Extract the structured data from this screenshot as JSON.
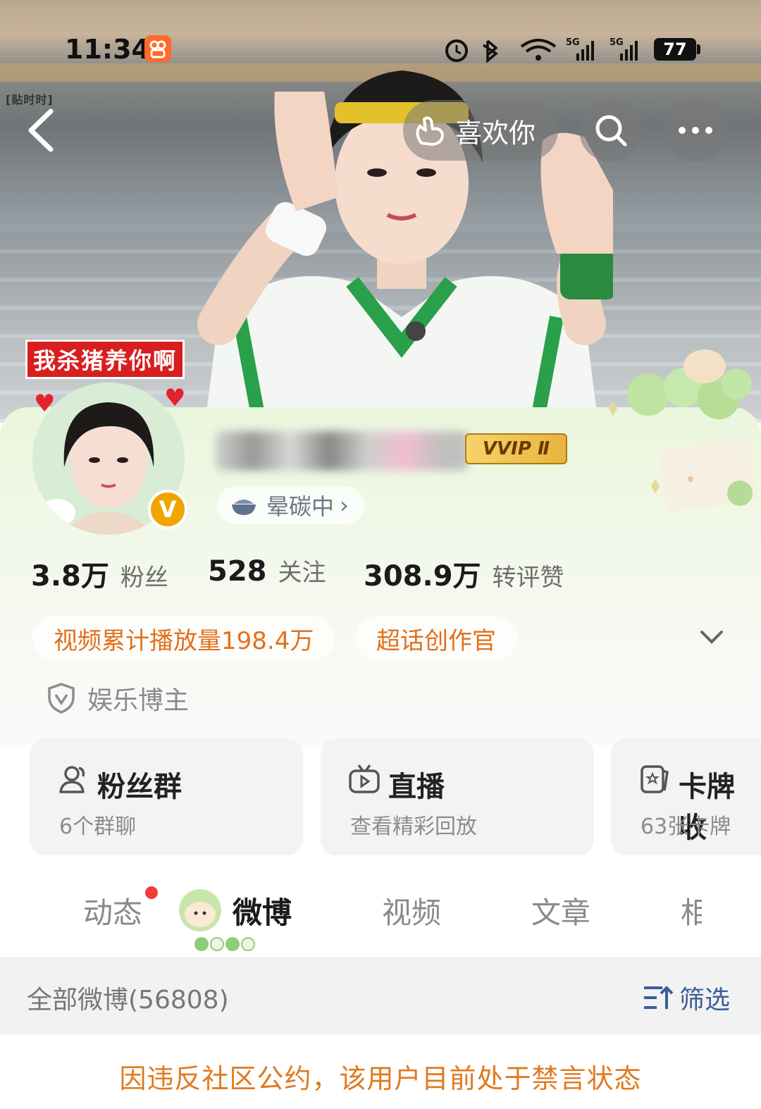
{
  "status_bar": {
    "time": "11:34",
    "battery": "77",
    "net_1": "5G",
    "net_2": "5G"
  },
  "cover": {
    "watermark": "[贴时时]"
  },
  "nav": {
    "like_label": "喜欢你"
  },
  "profile": {
    "avatar_tag": "我杀猪养你啊",
    "verified_badge": "V",
    "vip_badge": "VVIP Ⅱ",
    "status_text": "晕碳中",
    "stats": [
      {
        "value": "3.8万",
        "label": "粉丝"
      },
      {
        "value": "528",
        "label": "关注"
      },
      {
        "value": "308.9万",
        "label": "转评赞"
      }
    ],
    "highlights": [
      "视频累计播放量198.4万",
      "超话创作官"
    ],
    "role": "娱乐博主"
  },
  "features": [
    {
      "title": "粉丝群",
      "subtitle": "6个群聊",
      "icon": "people-icon"
    },
    {
      "title": "直播",
      "subtitle": "查看精彩回放",
      "icon": "tv-icon"
    },
    {
      "title": "卡牌收",
      "subtitle": "63张卡牌",
      "icon": "card-icon"
    }
  ],
  "tabs": [
    {
      "label": "动态",
      "has_dot": true
    },
    {
      "label": "微博",
      "active": true
    },
    {
      "label": "视频"
    },
    {
      "label": "文章"
    },
    {
      "label": "相"
    }
  ],
  "filter_bar": {
    "count_label": "全部微博(56808)",
    "filter_label": "筛选"
  },
  "notice": "因违反社区公约，该用户目前处于禁言状态",
  "colors": {
    "accent_orange": "#e2701c",
    "filter_blue": "#3b5d9a",
    "banner_red": "#d81e1e"
  }
}
